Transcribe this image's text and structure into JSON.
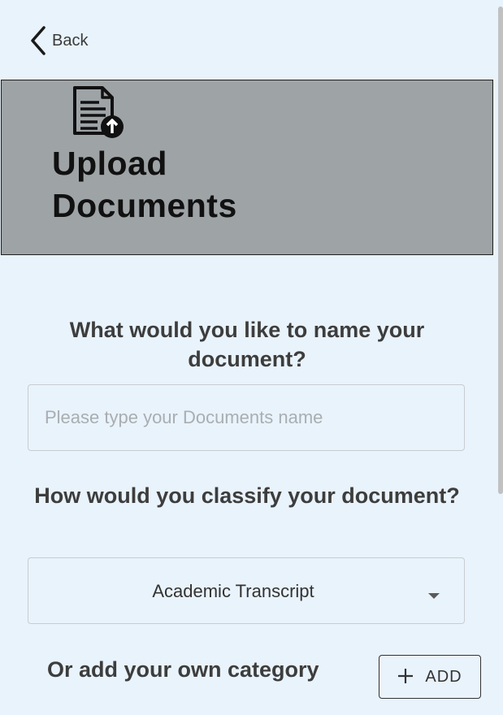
{
  "nav": {
    "back_label": "Back",
    "back_icon": "chevron-left-icon"
  },
  "banner": {
    "title": "Upload\nDocuments",
    "icon": "document-upload-icon",
    "background": "#9ea3a6"
  },
  "form": {
    "name_question": "What would you like to name your document?",
    "name_placeholder": "Please type your Documents name",
    "name_value": "",
    "classify_question": "How would you classify your document?",
    "category_selected": "Academic Transcript",
    "add_category_label": "Or add your own category",
    "add_button_label": "ADD",
    "add_button_icon": "plus-icon"
  },
  "colors": {
    "page_background": "#e9f3fb",
    "text": "#3d3d3d",
    "placeholder": "#a9aeb2"
  }
}
